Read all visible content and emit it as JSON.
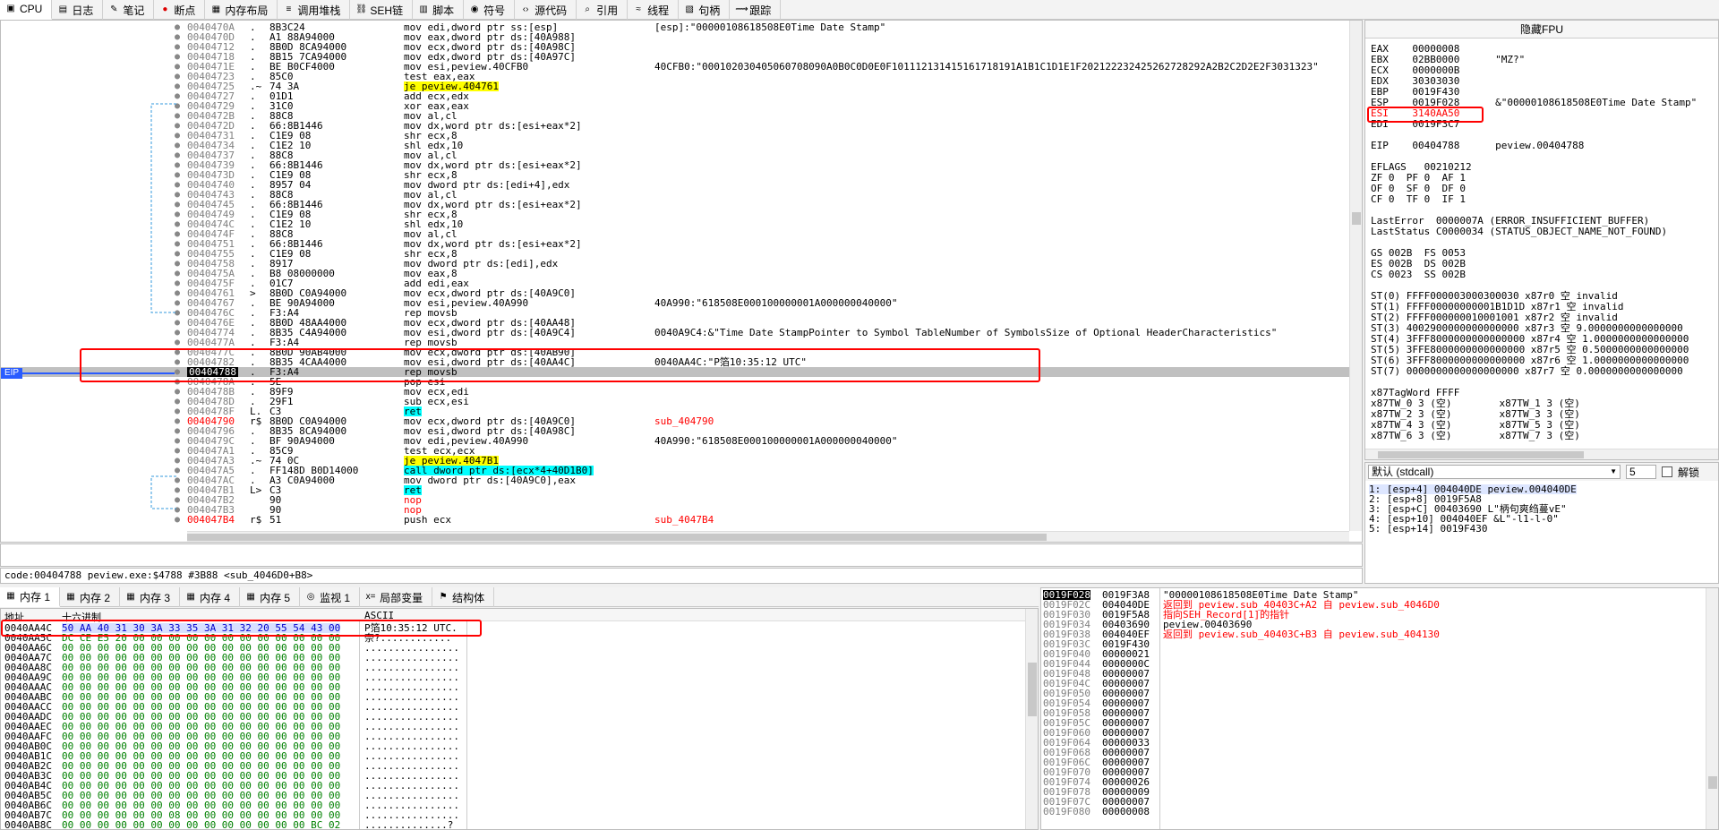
{
  "tabs": [
    {
      "label": "CPU",
      "icon": "cpu-icon",
      "active": true
    },
    {
      "label": "日志",
      "icon": "log-icon"
    },
    {
      "label": "笔记",
      "icon": "notes-icon"
    },
    {
      "label": "断点",
      "icon": "breakpoint-icon"
    },
    {
      "label": "内存布局",
      "icon": "memory-map-icon"
    },
    {
      "label": "调用堆栈",
      "icon": "call-stack-icon"
    },
    {
      "label": "SEH链",
      "icon": "seh-icon"
    },
    {
      "label": "脚本",
      "icon": "script-icon"
    },
    {
      "label": "符号",
      "icon": "symbols-icon"
    },
    {
      "label": "源代码",
      "icon": "source-icon"
    },
    {
      "label": "引用",
      "icon": "references-icon"
    },
    {
      "label": "线程",
      "icon": "threads-icon"
    },
    {
      "label": "句柄",
      "icon": "handles-icon"
    },
    {
      "label": "跟踪",
      "icon": "trace-icon"
    }
  ],
  "eip_label": "EIP",
  "disasm": [
    {
      "addr": "0040470A",
      "mark": ".",
      "bytes": "8B3C24",
      "asm": "mov edi,dword ptr ss:[esp]",
      "cmt": "[esp]:\"00000108618508E0Time Date Stamp\""
    },
    {
      "addr": "0040470D",
      "mark": ".",
      "bytes": "A1 88A94000",
      "asm": "mov eax,dword ptr ds:[40A988]",
      "cmt": ""
    },
    {
      "addr": "00404712",
      "mark": ".",
      "bytes": "8B0D 8CA94000",
      "asm": "mov ecx,dword ptr ds:[40A98C]",
      "cmt": ""
    },
    {
      "addr": "00404718",
      "mark": ".",
      "bytes": "8B15 7CA94000",
      "asm": "mov edx,dword ptr ds:[40A97C]",
      "cmt": ""
    },
    {
      "addr": "0040471E",
      "mark": ".",
      "bytes": "BE B0CF4000",
      "asm": "mov esi,peview.40CFB0",
      "cmt": "40CFB0:\"000102030405060708090A0B0C0D0E0F101112131415161718191A1B1C1D1E1F202122232425262728292A2B2C2D2E2F3031323\""
    },
    {
      "addr": "00404723",
      "mark": ".",
      "bytes": "85C0",
      "asm": "test eax,eax",
      "cmt": ""
    },
    {
      "addr": "00404725",
      "mark": ".~",
      "bytes": "74 3A",
      "asm": "je peview.404761",
      "cmt": ""
    },
    {
      "addr": "00404727",
      "mark": ".",
      "bytes": "01D1",
      "asm": "add ecx,edx",
      "cmt": ""
    },
    {
      "addr": "00404729",
      "mark": ".",
      "bytes": "31C0",
      "asm": "xor eax,eax",
      "cmt": ""
    },
    {
      "addr": "0040472B",
      "mark": ".",
      "bytes": "88C8",
      "asm": "mov al,cl",
      "cmt": ""
    },
    {
      "addr": "0040472D",
      "mark": ".",
      "bytes": "66:8B1446",
      "asm": "mov dx,word ptr ds:[esi+eax*2]",
      "cmt": ""
    },
    {
      "addr": "00404731",
      "mark": ".",
      "bytes": "C1E9 08",
      "asm": "shr ecx,8",
      "cmt": ""
    },
    {
      "addr": "00404734",
      "mark": ".",
      "bytes": "C1E2 10",
      "asm": "shl edx,10",
      "cmt": ""
    },
    {
      "addr": "00404737",
      "mark": ".",
      "bytes": "88C8",
      "asm": "mov al,cl",
      "cmt": ""
    },
    {
      "addr": "00404739",
      "mark": ".",
      "bytes": "66:8B1446",
      "asm": "mov dx,word ptr ds:[esi+eax*2]",
      "cmt": ""
    },
    {
      "addr": "0040473D",
      "mark": ".",
      "bytes": "C1E9 08",
      "asm": "shr ecx,8",
      "cmt": ""
    },
    {
      "addr": "00404740",
      "mark": ".",
      "bytes": "8957 04",
      "asm": "mov dword ptr ds:[edi+4],edx",
      "cmt": ""
    },
    {
      "addr": "00404743",
      "mark": ".",
      "bytes": "88C8",
      "asm": "mov al,cl",
      "cmt": ""
    },
    {
      "addr": "00404745",
      "mark": ".",
      "bytes": "66:8B1446",
      "asm": "mov dx,word ptr ds:[esi+eax*2]",
      "cmt": ""
    },
    {
      "addr": "00404749",
      "mark": ".",
      "bytes": "C1E9 08",
      "asm": "shr ecx,8",
      "cmt": ""
    },
    {
      "addr": "0040474C",
      "mark": ".",
      "bytes": "C1E2 10",
      "asm": "shl edx,10",
      "cmt": ""
    },
    {
      "addr": "0040474F",
      "mark": ".",
      "bytes": "88C8",
      "asm": "mov al,cl",
      "cmt": ""
    },
    {
      "addr": "00404751",
      "mark": ".",
      "bytes": "66:8B1446",
      "asm": "mov dx,word ptr ds:[esi+eax*2]",
      "cmt": ""
    },
    {
      "addr": "00404755",
      "mark": ".",
      "bytes": "C1E9 08",
      "asm": "shr ecx,8",
      "cmt": ""
    },
    {
      "addr": "00404758",
      "mark": ".",
      "bytes": "8917",
      "asm": "mov dword ptr ds:[edi],edx",
      "cmt": ""
    },
    {
      "addr": "0040475A",
      "mark": ".",
      "bytes": "B8 08000000",
      "asm": "mov eax,8",
      "cmt": ""
    },
    {
      "addr": "0040475F",
      "mark": ".",
      "bytes": "01C7",
      "asm": "add edi,eax",
      "cmt": ""
    },
    {
      "addr": "00404761",
      "mark": ">",
      "bytes": "8B0D C0A94000",
      "asm": "mov ecx,dword ptr ds:[40A9C0]",
      "cmt": ""
    },
    {
      "addr": "00404767",
      "mark": ".",
      "bytes": "BE 90A94000",
      "asm": "mov esi,peview.40A990",
      "cmt": "40A990:\"618508E000100000001A000000040000\""
    },
    {
      "addr": "0040476C",
      "mark": ".",
      "bytes": "F3:A4",
      "asm": "rep movsb",
      "cmt": ""
    },
    {
      "addr": "0040476E",
      "mark": ".",
      "bytes": "8B0D 48AA4000",
      "asm": "mov ecx,dword ptr ds:[40AA48]",
      "cmt": ""
    },
    {
      "addr": "00404774",
      "mark": ".",
      "bytes": "8B35 C4A94000",
      "asm": "mov esi,dword ptr ds:[40A9C4]",
      "cmt": "0040A9C4:&\"Time Date StampPointer to Symbol TableNumber of SymbolsSize of Optional HeaderCharacteristics\""
    },
    {
      "addr": "0040477A",
      "mark": ".",
      "bytes": "F3:A4",
      "asm": "rep movsb",
      "cmt": ""
    },
    {
      "addr": "0040477C",
      "mark": ".",
      "bytes": "8B0D 90AB4000",
      "asm": "mov ecx,dword ptr ds:[40AB90]",
      "cmt": ""
    },
    {
      "addr": "00404782",
      "mark": ".",
      "bytes": "8B35 4CAA4000",
      "asm": "mov esi,dword ptr ds:[40AA4C]",
      "cmt": "0040AA4C:\"P箔10:35:12 UTC\""
    },
    {
      "addr": "00404788",
      "mark": ".",
      "bytes": "F3:A4",
      "asm": "rep movsb",
      "cmt": "",
      "eip": true
    },
    {
      "addr": "0040478A",
      "mark": ".",
      "bytes": "5E",
      "asm": "pop esi",
      "cmt": ""
    },
    {
      "addr": "0040478B",
      "mark": ".",
      "bytes": "89F9",
      "asm": "mov ecx,edi",
      "cmt": ""
    },
    {
      "addr": "0040478D",
      "mark": ".",
      "bytes": "29F1",
      "asm": "sub ecx,esi",
      "cmt": ""
    },
    {
      "addr": "0040478F",
      "mark": "L.",
      "bytes": "C3",
      "asm": "ret",
      "cmt": ""
    },
    {
      "addr": "00404790",
      "mark": "r$",
      "bytes": "8B0D C0A94000",
      "asm": "mov ecx,dword ptr ds:[40A9C0]",
      "cmt": "sub_404790",
      "addr_red": true
    },
    {
      "addr": "00404796",
      "mark": ".",
      "bytes": "8B35 8CA94000",
      "asm": "mov esi,dword ptr ds:[40A98C]",
      "cmt": ""
    },
    {
      "addr": "0040479C",
      "mark": ".",
      "bytes": "BF 90A94000",
      "asm": "mov edi,peview.40A990",
      "cmt": "40A990:\"618508E000100000001A000000040000\""
    },
    {
      "addr": "004047A1",
      "mark": ".",
      "bytes": "85C9",
      "asm": "test ecx,ecx",
      "cmt": ""
    },
    {
      "addr": "004047A3",
      "mark": ".~",
      "bytes": "74 0C",
      "asm": "je peview.4047B1",
      "cmt": ""
    },
    {
      "addr": "004047A5",
      "mark": ".",
      "bytes": "FF148D B0D14000",
      "asm": "call dword ptr ds:[ecx*4+40D1B0]",
      "cmt": ""
    },
    {
      "addr": "004047AC",
      "mark": ".",
      "bytes": "A3 C0A94000",
      "asm": "mov dword ptr ds:[40A9C0],eax",
      "cmt": ""
    },
    {
      "addr": "004047B1",
      "mark": "L>",
      "bytes": "C3",
      "asm": "ret",
      "cmt": ""
    },
    {
      "addr": "004047B2",
      "mark": "",
      "bytes": "90",
      "asm": "nop",
      "cmt": ""
    },
    {
      "addr": "004047B3",
      "mark": "",
      "bytes": "90",
      "asm": "nop",
      "cmt": ""
    },
    {
      "addr": "004047B4",
      "mark": "r$",
      "bytes": "51",
      "asm": "push ecx",
      "cmt": "sub_4047B4",
      "addr_red": true
    }
  ],
  "info_line": "code:00404788 peview.exe:$4788 #3B88 <sub_4046D0+B8>",
  "regs_title": "隐藏FPU",
  "regs": [
    {
      "text": "EAX    00000008"
    },
    {
      "text": "EBX    02BB0000      \"MZ?\""
    },
    {
      "text": "ECX    0000000B"
    },
    {
      "text": "EDX    30303030"
    },
    {
      "text": "EBP    0019F430"
    },
    {
      "text": "ESP    0019F028      &\"00000108618508E0Time Date Stamp\""
    },
    {
      "text": "ESI    3140AA50",
      "red": true
    },
    {
      "text": "EDI    0019F3C7"
    },
    {
      "text": ""
    },
    {
      "text": "EIP    00404788      peview.00404788"
    },
    {
      "text": ""
    },
    {
      "text": "EFLAGS   00210212"
    },
    {
      "text": "ZF 0  PF 0  AF 1"
    },
    {
      "text": "OF 0  SF 0  DF 0"
    },
    {
      "text": "CF 0  TF 0  IF 1"
    },
    {
      "text": ""
    },
    {
      "text": "LastError  0000007A (ERROR_INSUFFICIENT_BUFFER)"
    },
    {
      "text": "LastStatus C0000034 (STATUS_OBJECT_NAME_NOT_FOUND)"
    },
    {
      "text": ""
    },
    {
      "text": "GS 002B  FS 0053"
    },
    {
      "text": "ES 002B  DS 002B"
    },
    {
      "text": "CS 0023  SS 002B"
    },
    {
      "text": ""
    },
    {
      "text": "ST(0) FFFF000003000300030 x87r0 空 invalid"
    },
    {
      "text": "ST(1) FFFF00000000001B1D1D x87r1 空 invalid"
    },
    {
      "text": "ST(2) FFFF000000010001001 x87r2 空 invalid"
    },
    {
      "text": "ST(3) 4002900000000000000 x87r3 空 9.0000000000000000"
    },
    {
      "text": "ST(4) 3FFF8000000000000000 x87r4 空 1.0000000000000000"
    },
    {
      "text": "ST(5) 3FFE8000000000000000 x87r5 空 0.5000000000000000"
    },
    {
      "text": "ST(6) 3FFF8000000000000000 x87r6 空 1.0000000000000000"
    },
    {
      "text": "ST(7) 0000000000000000000 x87r7 空 0.0000000000000000"
    },
    {
      "text": ""
    },
    {
      "text": "x87TagWord FFFF"
    },
    {
      "text": "x87TW_0 3 (空)        x87TW_1 3 (空)"
    },
    {
      "text": "x87TW_2 3 (空)        x87TW_3 3 (空)"
    },
    {
      "text": "x87TW_4 3 (空)        x87TW_5 3 (空)"
    },
    {
      "text": "x87TW_6 3 (空)        x87TW_7 3 (空)"
    }
  ],
  "args": {
    "convention": "默认 (stdcall)",
    "count": "5",
    "unlock_label": "解锁",
    "rows": [
      "1: [esp+4] 004040DE peview.004040DE",
      "2: [esp+8] 0019F5A8",
      "3: [esp+C] 00403690 L\"柄句爽绉蔓vE\"",
      "4: [esp+10] 004040EF &L\"-l1-l-0\"",
      "5: [esp+14] 0019F430"
    ]
  },
  "memtabs": [
    {
      "label": "内存 1",
      "icon": "memory-icon",
      "active": true
    },
    {
      "label": "内存 2",
      "icon": "memory-icon"
    },
    {
      "label": "内存 3",
      "icon": "memory-icon"
    },
    {
      "label": "内存 4",
      "icon": "memory-icon"
    },
    {
      "label": "内存 5",
      "icon": "memory-icon"
    },
    {
      "label": "监视 1",
      "icon": "watch-icon"
    },
    {
      "label": "局部变量",
      "icon": "locals-icon"
    },
    {
      "label": "结构体",
      "icon": "struct-icon"
    }
  ],
  "dump_headers": {
    "addr": "地址",
    "hex": "十六进制",
    "ascii": "ASCII"
  },
  "dump": [
    {
      "addr": "0040AA4C",
      "hex": "50 AA 40 31 30 3A 33 35 3A 31 32 20 55 54 43 00",
      "ascii": "P箔10:35:12 UTC."
    },
    {
      "addr": "0040AA5C",
      "hex": "DC CE E5 20 00 00 00 00 00 00 00 00 00 00 00 00",
      "ascii": "奈?............"
    },
    {
      "addr": "0040AA6C",
      "hex": "00 00 00 00 00 00 00 00 00 00 00 00 00 00 00 00",
      "ascii": "................"
    },
    {
      "addr": "0040AA7C",
      "hex": "00 00 00 00 00 00 00 00 00 00 00 00 00 00 00 00",
      "ascii": "................"
    },
    {
      "addr": "0040AA8C",
      "hex": "00 00 00 00 00 00 00 00 00 00 00 00 00 00 00 00",
      "ascii": "................"
    },
    {
      "addr": "0040AA9C",
      "hex": "00 00 00 00 00 00 00 00 00 00 00 00 00 00 00 00",
      "ascii": "................"
    },
    {
      "addr": "0040AAAC",
      "hex": "00 00 00 00 00 00 00 00 00 00 00 00 00 00 00 00",
      "ascii": "................"
    },
    {
      "addr": "0040AABC",
      "hex": "00 00 00 00 00 00 00 00 00 00 00 00 00 00 00 00",
      "ascii": "................"
    },
    {
      "addr": "0040AACC",
      "hex": "00 00 00 00 00 00 00 00 00 00 00 00 00 00 00 00",
      "ascii": "................"
    },
    {
      "addr": "0040AADC",
      "hex": "00 00 00 00 00 00 00 00 00 00 00 00 00 00 00 00",
      "ascii": "................"
    },
    {
      "addr": "0040AAEC",
      "hex": "00 00 00 00 00 00 00 00 00 00 00 00 00 00 00 00",
      "ascii": "................"
    },
    {
      "addr": "0040AAFC",
      "hex": "00 00 00 00 00 00 00 00 00 00 00 00 00 00 00 00",
      "ascii": "................"
    },
    {
      "addr": "0040AB0C",
      "hex": "00 00 00 00 00 00 00 00 00 00 00 00 00 00 00 00",
      "ascii": "................"
    },
    {
      "addr": "0040AB1C",
      "hex": "00 00 00 00 00 00 00 00 00 00 00 00 00 00 00 00",
      "ascii": "................"
    },
    {
      "addr": "0040AB2C",
      "hex": "00 00 00 00 00 00 00 00 00 00 00 00 00 00 00 00",
      "ascii": "................"
    },
    {
      "addr": "0040AB3C",
      "hex": "00 00 00 00 00 00 00 00 00 00 00 00 00 00 00 00",
      "ascii": "................"
    },
    {
      "addr": "0040AB4C",
      "hex": "00 00 00 00 00 00 00 00 00 00 00 00 00 00 00 00",
      "ascii": "................"
    },
    {
      "addr": "0040AB5C",
      "hex": "00 00 00 00 00 00 00 00 00 00 00 00 00 00 00 00",
      "ascii": "................"
    },
    {
      "addr": "0040AB6C",
      "hex": "00 00 00 00 00 00 00 00 00 00 00 00 00 00 00 00",
      "ascii": "................"
    },
    {
      "addr": "0040AB7C",
      "hex": "00 00 00 00 00 00 08 00 00 00 00 00 00 00 00 00",
      "ascii": "................"
    },
    {
      "addr": "0040AB8C",
      "hex": "00 00 00 00 00 00 00 00 00 00 00 00 00 00 BC 02",
      "ascii": "..............?"
    }
  ],
  "stack": [
    {
      "addr": "0019F028",
      "val": "0019F3A8",
      "cmt": "\"00000108618508E0Time Date Stamp\"",
      "sel": true
    },
    {
      "addr": "0019F02C",
      "val": "004040DE",
      "cmt": "返回到 peview.sub_40403C+A2 自 peview.sub_4046D0",
      "red": true
    },
    {
      "addr": "0019F030",
      "val": "0019F5A8",
      "cmt": "指向SEH_Record[1]的指针",
      "red": true
    },
    {
      "addr": "0019F034",
      "val": "00403690",
      "cmt": "peview.00403690"
    },
    {
      "addr": "0019F038",
      "val": "004040EF",
      "cmt": "返回到 peview.sub_40403C+B3 自 peview.sub_404130",
      "red": true
    },
    {
      "addr": "0019F03C",
      "val": "0019F430",
      "cmt": ""
    },
    {
      "addr": "0019F040",
      "val": "00000021",
      "cmt": ""
    },
    {
      "addr": "0019F044",
      "val": "0000000C",
      "cmt": ""
    },
    {
      "addr": "0019F048",
      "val": "00000007",
      "cmt": ""
    },
    {
      "addr": "0019F04C",
      "val": "00000007",
      "cmt": ""
    },
    {
      "addr": "0019F050",
      "val": "00000007",
      "cmt": ""
    },
    {
      "addr": "0019F054",
      "val": "00000007",
      "cmt": ""
    },
    {
      "addr": "0019F058",
      "val": "00000007",
      "cmt": ""
    },
    {
      "addr": "0019F05C",
      "val": "00000007",
      "cmt": ""
    },
    {
      "addr": "0019F060",
      "val": "00000007",
      "cmt": ""
    },
    {
      "addr": "0019F064",
      "val": "00000033",
      "cmt": ""
    },
    {
      "addr": "0019F068",
      "val": "00000007",
      "cmt": ""
    },
    {
      "addr": "0019F06C",
      "val": "00000007",
      "cmt": ""
    },
    {
      "addr": "0019F070",
      "val": "00000007",
      "cmt": ""
    },
    {
      "addr": "0019F074",
      "val": "00000026",
      "cmt": ""
    },
    {
      "addr": "0019F078",
      "val": "00000009",
      "cmt": ""
    },
    {
      "addr": "0019F07C",
      "val": "00000007",
      "cmt": ""
    },
    {
      "addr": "0019F080",
      "val": "00000008",
      "cmt": ""
    }
  ]
}
